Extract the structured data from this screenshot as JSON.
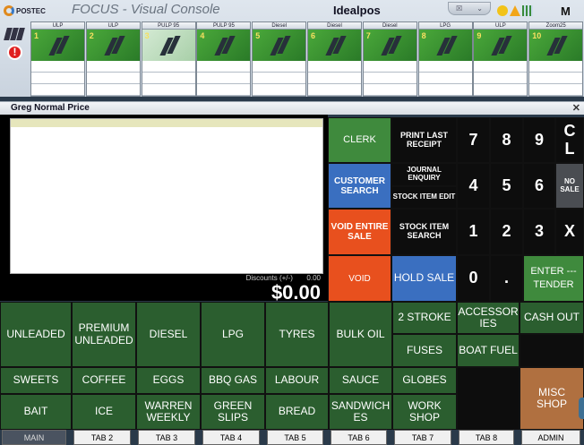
{
  "header": {
    "brand": "POSTEC",
    "app_title": "FOCUS - Visual Console",
    "site_name": "Idealpos",
    "mode_label": "M",
    "win_btn_1": "☒",
    "win_btn_2": "⌄"
  },
  "pumps": [
    {
      "fuel": "ULP",
      "number": "1"
    },
    {
      "fuel": "ULP",
      "number": "2"
    },
    {
      "fuel": "PULP 95",
      "number": "3"
    },
    {
      "fuel": "PULP 95",
      "number": "4"
    },
    {
      "fuel": "Diesel",
      "number": "5"
    },
    {
      "fuel": "Diesel",
      "number": "6"
    },
    {
      "fuel": "Diesel",
      "number": "7"
    },
    {
      "fuel": "LPG",
      "number": "8"
    },
    {
      "fuel": "ULP",
      "number": "9"
    },
    {
      "fuel": "Zoom25",
      "number": "10"
    }
  ],
  "sale": {
    "title": "Greg  Normal Price",
    "discounts_label": "Discounts (+/-)",
    "discounts_value": "0.00",
    "total": "$0.00"
  },
  "functions": {
    "clerk": "CLERK",
    "print_last_receipt": "PRINT LAST RECEIPT",
    "customer_search": "CUSTOMER SEARCH",
    "journal_enquiry": "JOURNAL ENQUIRY",
    "stock_item_edit": "STOCK ITEM EDIT",
    "void_entire_sale": "VOID ENTIRE SALE",
    "stock_item_search": "STOCK ITEM SEARCH",
    "void": "VOID",
    "hold_sale": "HOLD SALE"
  },
  "keypad": {
    "k7": "7",
    "k8": "8",
    "k9": "9",
    "cl": "C L",
    "k4": "4",
    "k5": "5",
    "k6": "6",
    "no_sale": "NO SALE",
    "k1": "1",
    "k2": "2",
    "k3": "3",
    "x": "X",
    "k0": "0",
    "dot": ".",
    "enter": "ENTER --- TENDER"
  },
  "items": {
    "unleaded": "UNLEADED",
    "premium_unleaded": "PREMIUM UNLEADED",
    "diesel": "DIESEL",
    "lpg": "LPG",
    "tyres": "TYRES",
    "bulk_oil": "BULK OIL",
    "two_stroke": "2 STROKE",
    "accessories": "ACCESSOR IES",
    "cash_out": "CASH OUT",
    "fuses": "FUSES",
    "boat_fuel": "BOAT FUEL",
    "sweets": "SWEETS",
    "coffee": "COFFEE",
    "eggs": "EGGS",
    "bbq_gas": "BBQ GAS",
    "labour": "LABOUR",
    "sauce": "SAUCE",
    "globes": "GLOBES",
    "bait": "BAIT",
    "ice": "ICE",
    "warren_weekly": "WARREN WEEKLY",
    "green_slips": "GREEN SLIPS",
    "bread": "BREAD",
    "sandwiches": "SANDWICH ES",
    "work_shop": "WORK SHOP",
    "misc_shop": "MISC SHOP"
  },
  "tabs": [
    "MAIN",
    "TAB 2",
    "TAB 3",
    "TAB 4",
    "TAB 5",
    "TAB 6",
    "TAB 7",
    "TAB 8",
    "ADMIN"
  ],
  "colors": {
    "green": "#3f8a3d",
    "dark_green": "#2b5e2f",
    "blue": "#3a6fc0",
    "red": "#e8501e",
    "black": "#0d0d0d",
    "brown": "#b07040"
  }
}
